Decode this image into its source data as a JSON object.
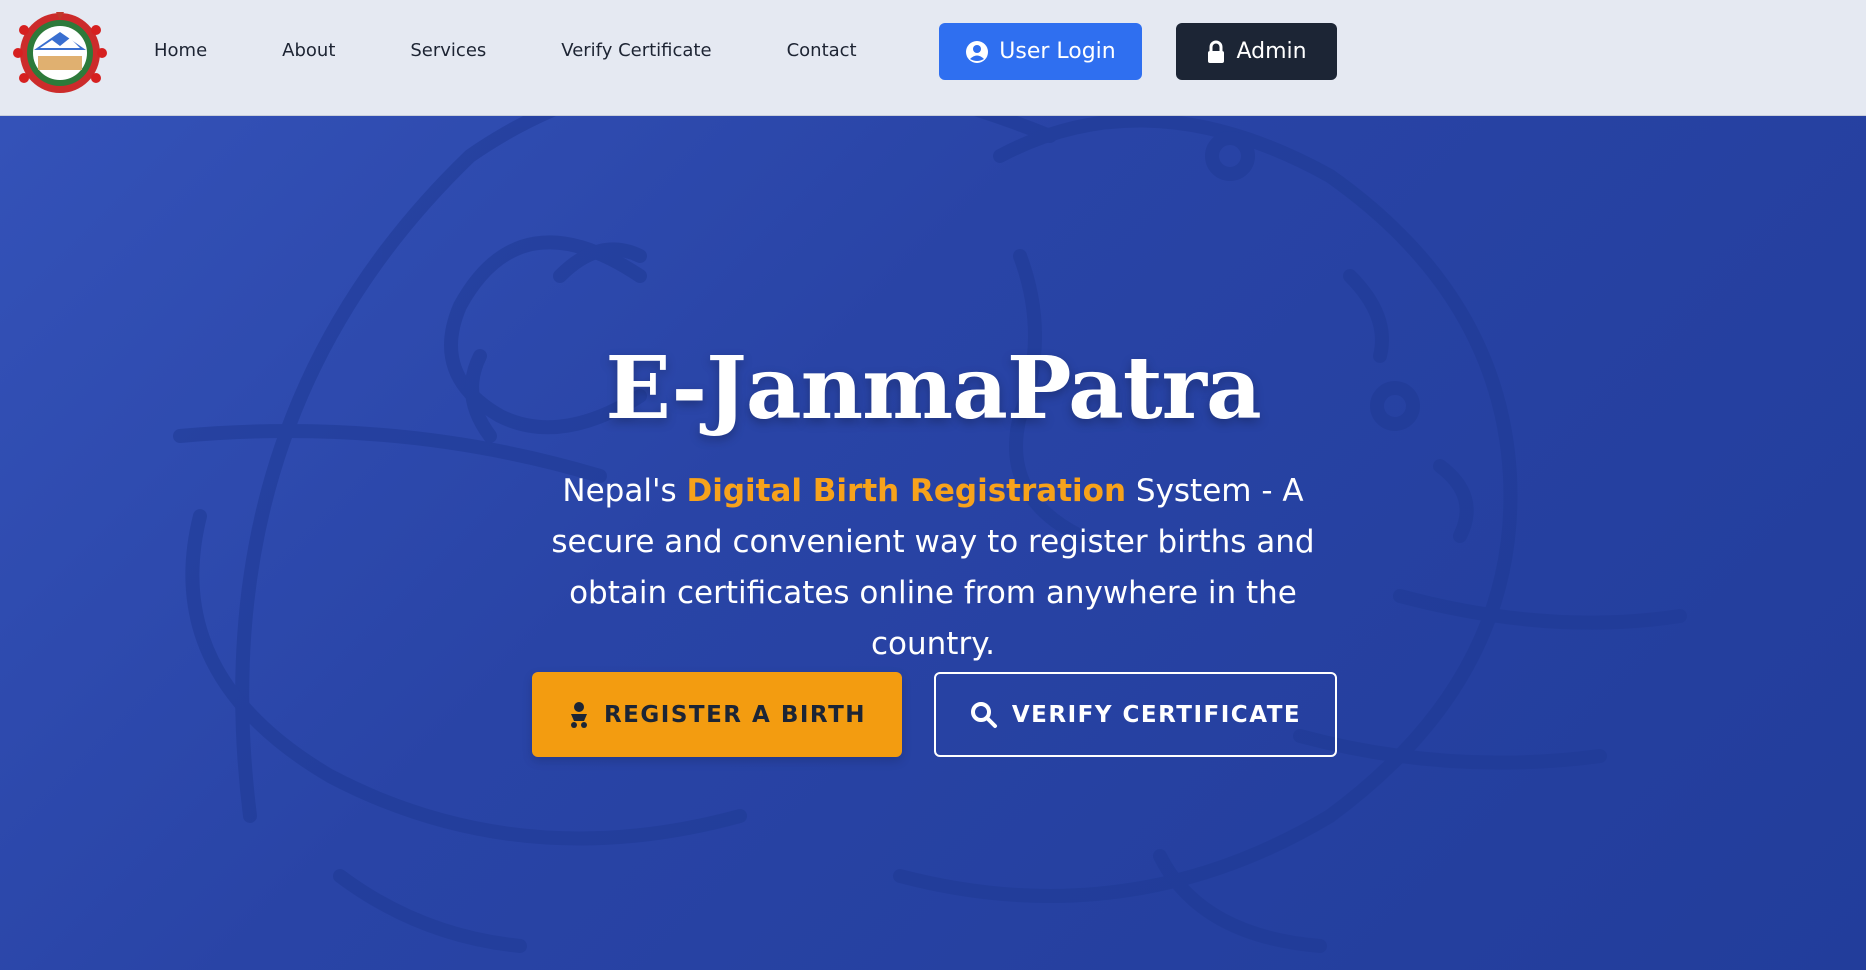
{
  "nav": {
    "logo": "nepal-emblem-logo",
    "links": [
      "Home",
      "About",
      "Services",
      "Verify Certificate",
      "Contact"
    ],
    "login_label": "User Login",
    "login_icon": "user-circle-icon",
    "admin_label": "Admin",
    "admin_icon": "lock-icon"
  },
  "hero": {
    "title": "E-JanmaPatra",
    "subtitle_prefix": "Nepal's ",
    "subtitle_highlight": "Digital Birth Registration",
    "subtitle_suffix": " System - A secure and convenient way to register births and obtain certificates online from anywhere in the country.",
    "register_label": "REGISTER A BIRTH",
    "register_icon": "baby-icon",
    "verify_label": "VERIFY CERTIFICATE",
    "verify_icon": "search-icon"
  },
  "colors": {
    "nav_bg": "#e5e9f2",
    "hero_bg": "#2944a6",
    "login_btn": "#2f6ff0",
    "admin_btn": "#1c2535",
    "accent": "#f39c10"
  }
}
